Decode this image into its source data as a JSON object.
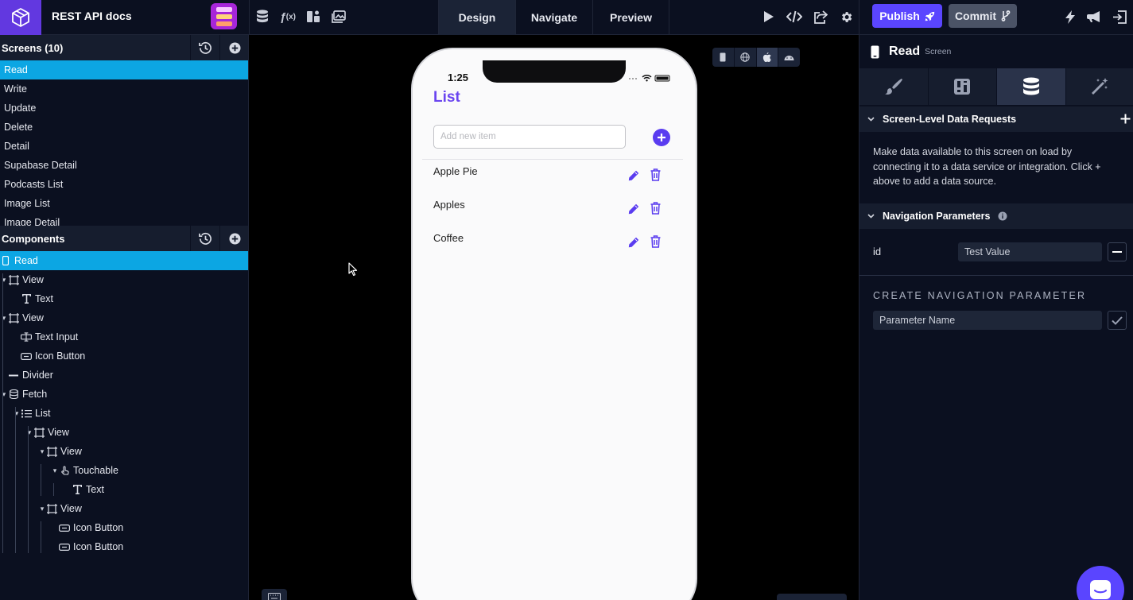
{
  "app": {
    "title": "REST API docs"
  },
  "topbar": {
    "tabs": [
      {
        "label": "Design",
        "active": true
      },
      {
        "label": "Navigate",
        "active": false
      },
      {
        "label": "Preview",
        "active": false
      }
    ],
    "publish_label": "Publish",
    "commit_label": "Commit"
  },
  "screens": {
    "header": "Screens (10)",
    "items": [
      "Read",
      "Write",
      "Update",
      "Delete",
      "Detail",
      "Supabase Detail",
      "Podcasts List",
      "Image List",
      "Image Detail"
    ],
    "selected": "Read"
  },
  "components": {
    "header": "Components",
    "tree": [
      {
        "label": "Read",
        "icon": "phone-icon",
        "depth": 0
      },
      {
        "label": "View",
        "icon": "view-icon",
        "depth": 1
      },
      {
        "label": "Text",
        "icon": "text-icon",
        "depth": 2
      },
      {
        "label": "View",
        "icon": "view-icon",
        "depth": 1
      },
      {
        "label": "Text Input",
        "icon": "text-input-icon",
        "depth": 2
      },
      {
        "label": "Icon Button",
        "icon": "icon-button-icon",
        "depth": 2
      },
      {
        "label": "Divider",
        "icon": "divider-icon",
        "depth": 1
      },
      {
        "label": "Fetch",
        "icon": "database-icon",
        "depth": 1
      },
      {
        "label": "List",
        "icon": "list-icon",
        "depth": 2
      },
      {
        "label": "View",
        "icon": "view-icon",
        "depth": 3
      },
      {
        "label": "View",
        "icon": "view-icon",
        "depth": 4
      },
      {
        "label": "Touchable",
        "icon": "touch-icon",
        "depth": 5
      },
      {
        "label": "Text",
        "icon": "text-icon",
        "depth": 6
      },
      {
        "label": "View",
        "icon": "view-icon",
        "depth": 4
      },
      {
        "label": "Icon Button",
        "icon": "icon-button-icon",
        "depth": 5
      },
      {
        "label": "Icon Button",
        "icon": "icon-button-icon",
        "depth": 5
      }
    ]
  },
  "phone": {
    "time": "1:25",
    "title": "List",
    "input_placeholder": "Add new item",
    "items": [
      "Apple Pie",
      "Apples",
      "Coffee"
    ]
  },
  "inspector": {
    "component_name": "Read",
    "component_kind": "Screen",
    "section_data": "Screen-Level Data Requests",
    "description": "Make data available to this screen on load by connecting it to a data service or integration. Click + above to add a data source.",
    "section_nav": "Navigation Parameters",
    "param_name": "id",
    "param_value": "Test Value",
    "create_label": "CREATE NAVIGATION PARAMETER",
    "create_placeholder": "Parameter Name"
  },
  "colors": {
    "brand": "#6238e0",
    "accent": "#5a45ff",
    "selection": "#0ca6e3",
    "list_title": "#6a45f0"
  }
}
